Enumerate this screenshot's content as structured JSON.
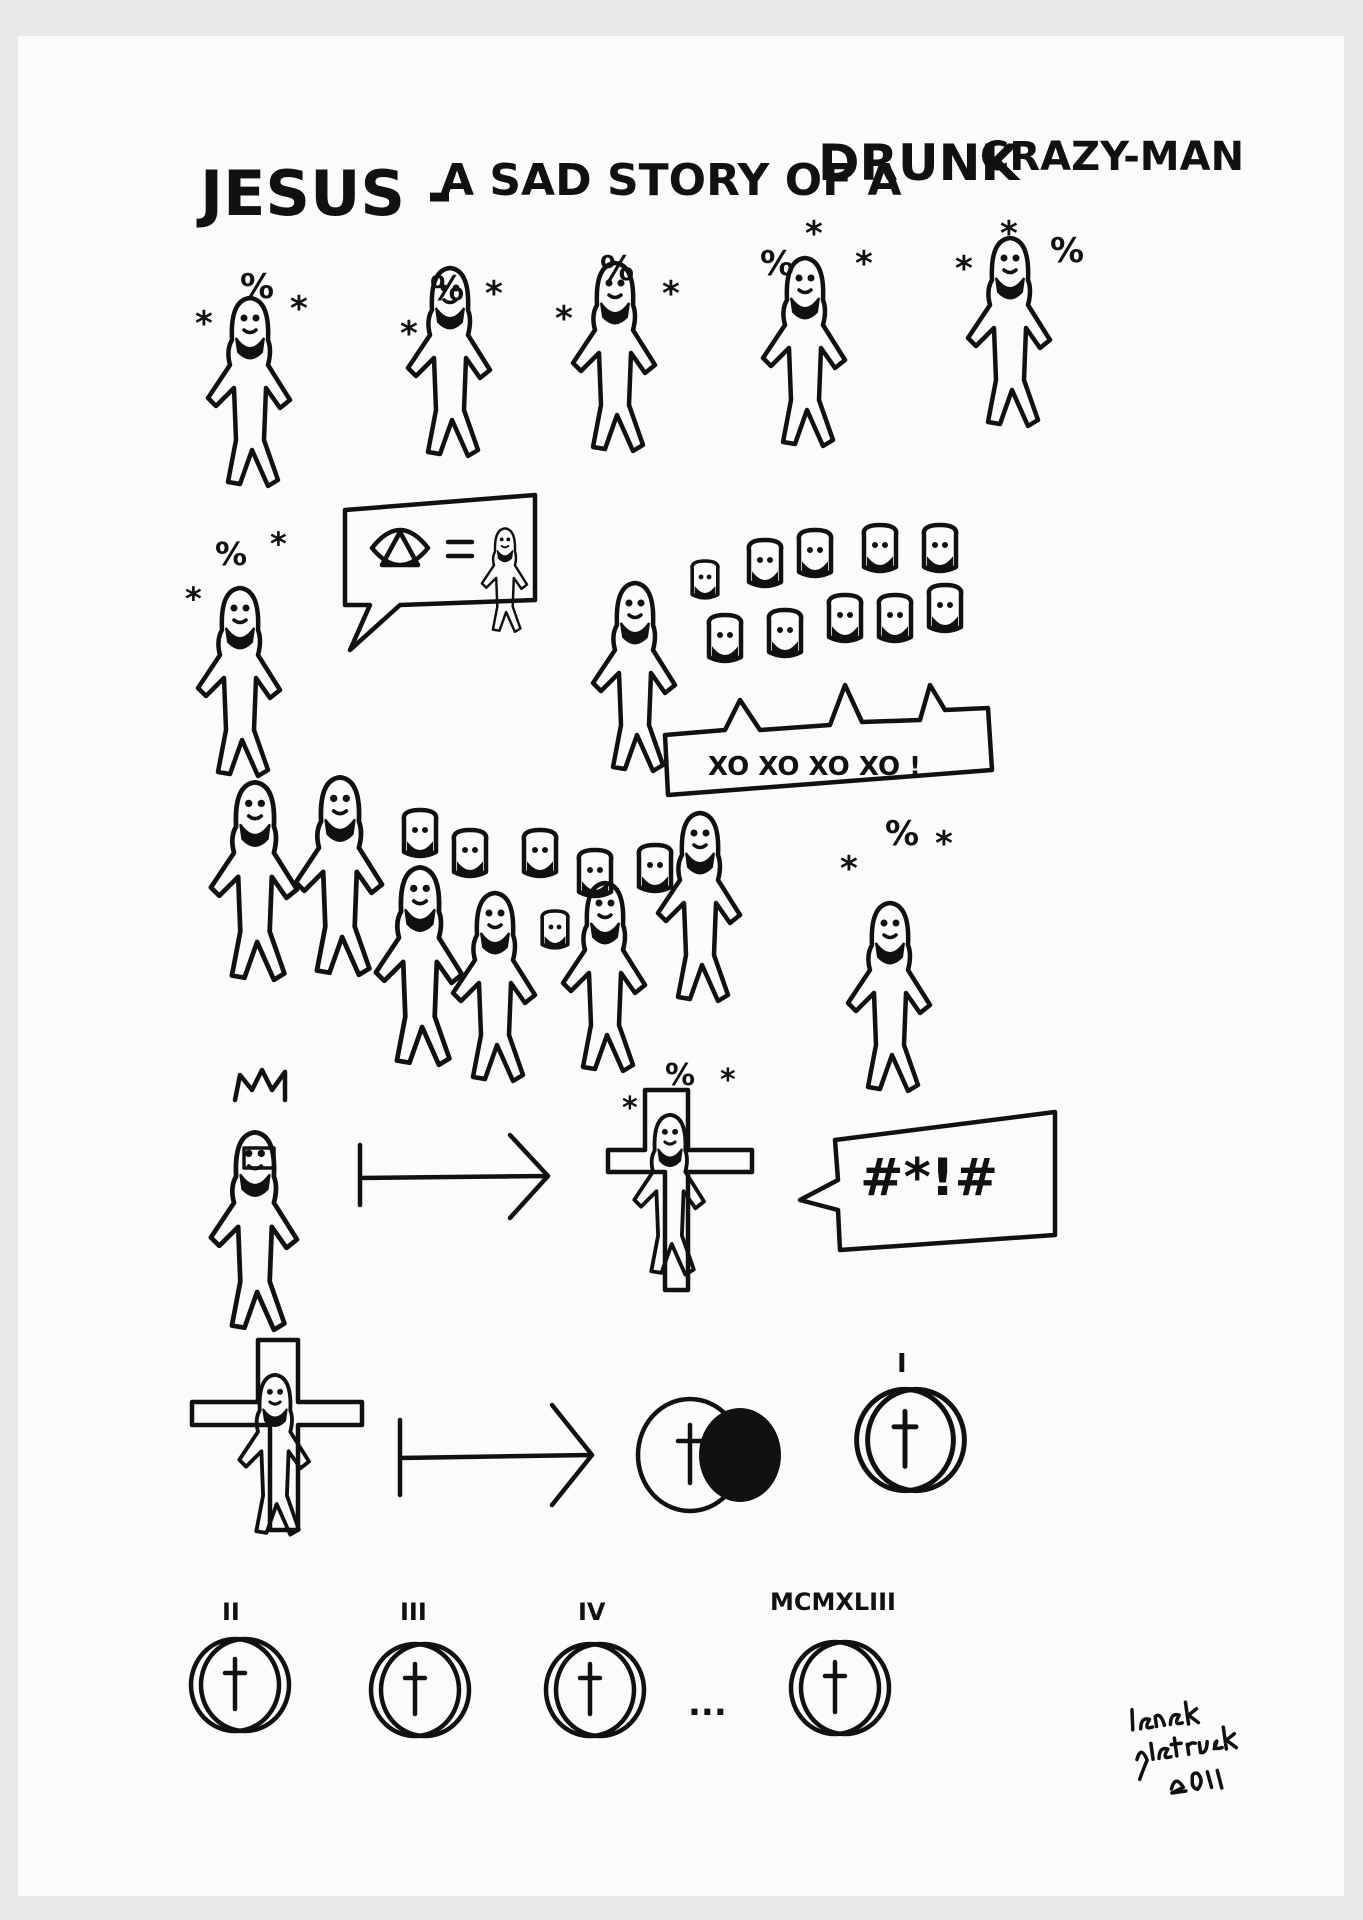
{
  "title": {
    "part1": "JESUS -",
    "part2": "A SAD STORY OF A",
    "part3": "DRUNK",
    "part4": "CRAZY-MAN"
  },
  "drunk_marks": [
    "%",
    "*"
  ],
  "speech": {
    "crowd_shout": "XO XO XO XO !",
    "curse": "#*!#"
  },
  "numerals": [
    "I",
    "II",
    "III",
    "IV",
    "MCMXLIII"
  ],
  "ellipsis": "...",
  "signature": "lenek pietrusk 2011"
}
